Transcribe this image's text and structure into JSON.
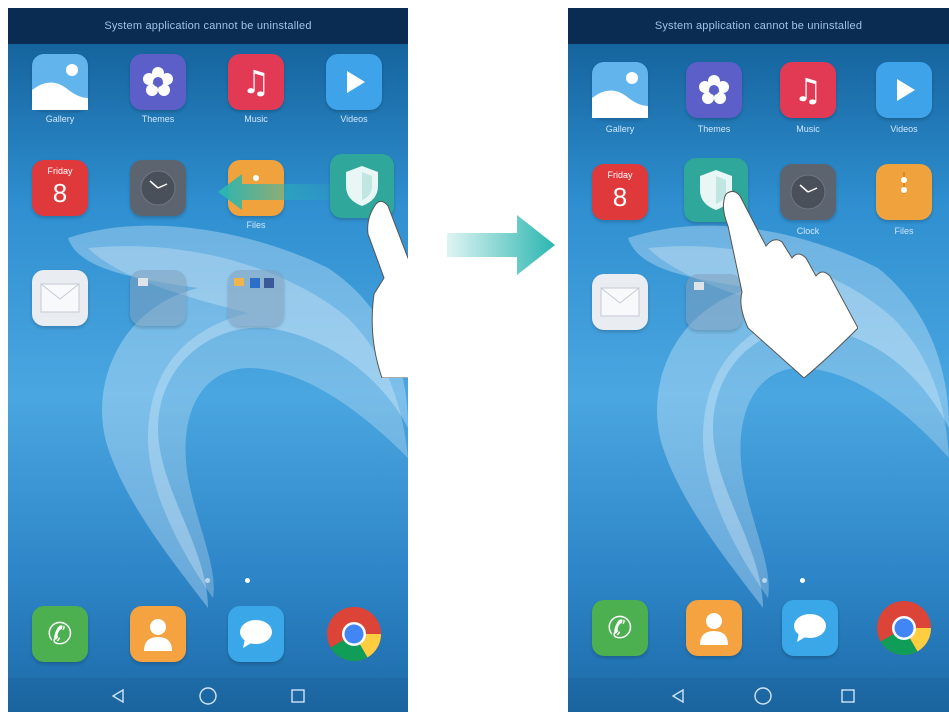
{
  "status_message": "System application cannot be uninstalled",
  "apps": {
    "gallery": "Gallery",
    "themes": "Themes",
    "music": "Music",
    "videos": "Videos",
    "clock": "Clock",
    "files": "Files"
  },
  "calendar": {
    "day": "Friday",
    "date": "8"
  },
  "colors": {
    "arrow": "#2bb6b0",
    "wallpaper": "#2f8fd0",
    "music": "#e23a55",
    "themes": "#5b5fc7",
    "calendar": "#e0393b",
    "files": "#f0a23d",
    "phone": "#4caf50",
    "contacts": "#f4a340",
    "messages": "#3aa8e8",
    "manager": "#2fa79a"
  },
  "icons": [
    "gallery-icon",
    "themes-icon",
    "music-icon",
    "videos-icon",
    "calendar-icon",
    "clock-icon",
    "files-icon",
    "phone-manager-icon",
    "email-icon",
    "folder-icon",
    "phone-icon",
    "contacts-icon",
    "messages-icon",
    "chrome-icon",
    "back-icon",
    "home-icon",
    "recents-icon",
    "hand-gesture-icon",
    "drag-arrow-icon",
    "transition-arrow-icon"
  ]
}
